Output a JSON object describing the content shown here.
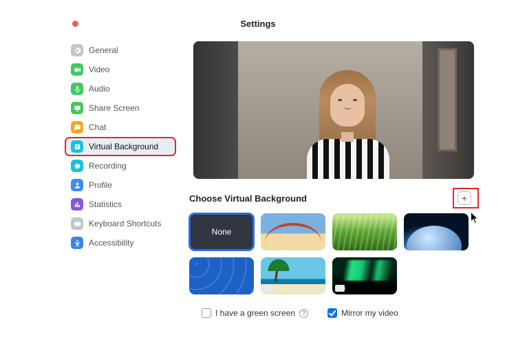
{
  "title": "Settings",
  "sidebar": {
    "items": [
      {
        "label": "General"
      },
      {
        "label": "Video"
      },
      {
        "label": "Audio"
      },
      {
        "label": "Share Screen"
      },
      {
        "label": "Chat"
      },
      {
        "label": "Virtual Background"
      },
      {
        "label": "Recording"
      },
      {
        "label": "Profile"
      },
      {
        "label": "Statistics"
      },
      {
        "label": "Keyboard Shortcuts"
      },
      {
        "label": "Accessibility"
      }
    ]
  },
  "main": {
    "section_title": "Choose Virtual Background",
    "thumbs": {
      "none_label": "None"
    },
    "green_screen_label": "I have a green screen",
    "mirror_label": "Mirror my video",
    "green_screen_checked": false,
    "mirror_checked": true
  }
}
